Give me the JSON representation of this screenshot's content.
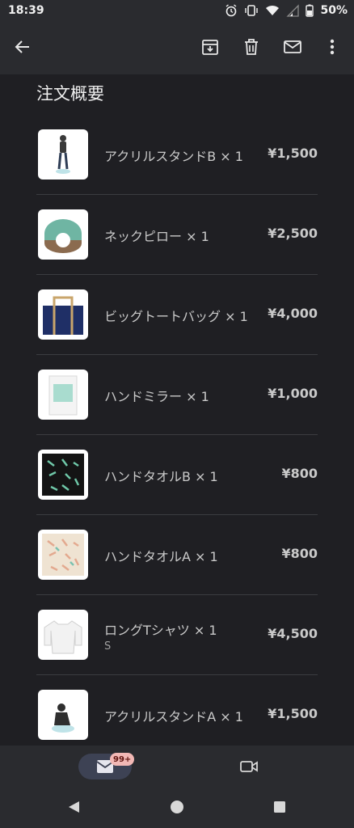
{
  "status_bar": {
    "time": "18:39",
    "battery": "50%",
    "icons": [
      "alarm-icon",
      "vibrate-icon",
      "wifi-icon",
      "signal-icon",
      "battery-icon"
    ]
  },
  "toolbar": {
    "icons": [
      "back-arrow-icon",
      "archive-icon",
      "delete-icon",
      "mail-icon",
      "more-vert-icon"
    ]
  },
  "section": {
    "title": "注文概要"
  },
  "items": [
    {
      "name": "アクリルスタンドB × 1",
      "price": "¥1,500",
      "variant": ""
    },
    {
      "name": "ネックピロー × 1",
      "price": "¥2,500",
      "variant": ""
    },
    {
      "name": "ビッグトートバッグ × 1",
      "price": "¥4,000",
      "variant": ""
    },
    {
      "name": "ハンドミラー × 1",
      "price": "¥1,000",
      "variant": ""
    },
    {
      "name": "ハンドタオルB × 1",
      "price": "¥800",
      "variant": ""
    },
    {
      "name": "ハンドタオルA × 1",
      "price": "¥800",
      "variant": ""
    },
    {
      "name": "ロングTシャツ × 1",
      "price": "¥4,500",
      "variant": "S"
    },
    {
      "name": "アクリルスタンドA × 1",
      "price": "¥1,500",
      "variant": ""
    }
  ],
  "bottom_nav": {
    "mail_badge": "99+"
  },
  "colors": {
    "background": "#1f1f23",
    "bar": "#2a2b2f",
    "divider": "#3b3c40",
    "pill": "#3d4254",
    "badge": "#f2b8b5"
  }
}
